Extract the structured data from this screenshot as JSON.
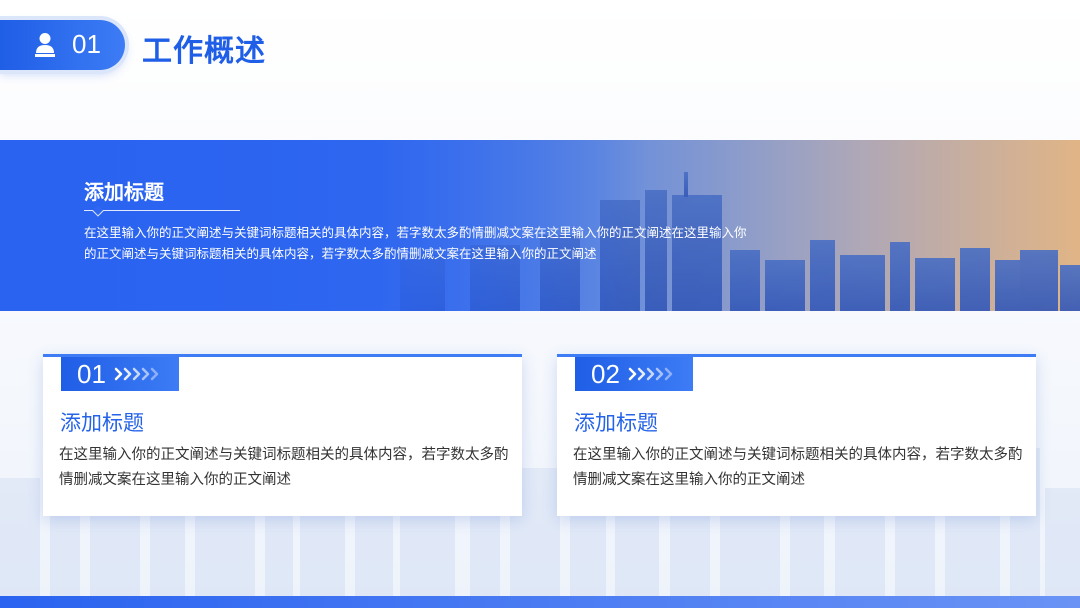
{
  "header": {
    "number": "01",
    "title": "工作概述"
  },
  "banner": {
    "title": "添加标题",
    "text": "在这里输入你的正文阐述与关键词标题相关的具体内容，若字数太多酌情删减文案在这里输入你的正文阐述在这里输入你的正文阐述与关键词标题相关的具体内容，若字数太多酌情删减文案在这里输入你的正文阐述"
  },
  "cards": [
    {
      "number": "01",
      "title": "添加标题",
      "text": "在这里输入你的正文阐述与关键词标题相关的具体内容，若字数太多酌情删减文案在这里输入你的正文阐述"
    },
    {
      "number": "02",
      "title": "添加标题",
      "text": "在这里输入你的正文阐述与关键词标题相关的具体内容，若字数太多酌情删减文案在这里输入你的正文阐述"
    }
  ],
  "colors": {
    "accent": "#1f5ee6",
    "accent_light": "#3d7cf5",
    "text": "#333333"
  },
  "icons": {
    "header_icon": "user-icon",
    "tag_icon": "chevrons-right-icon"
  }
}
